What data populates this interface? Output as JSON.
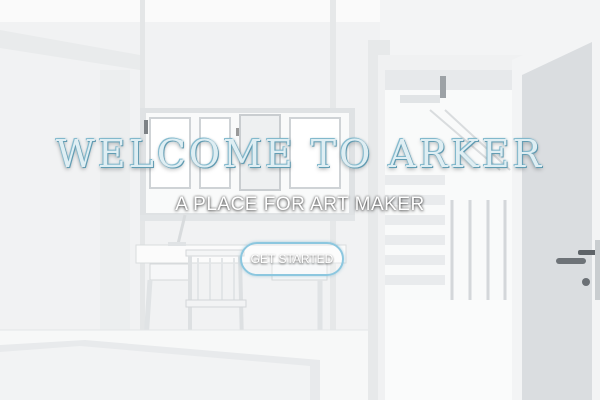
{
  "hero": {
    "title": "WELCOME TO ARKER",
    "subtitle": "A PLACE FOR ART MAKER",
    "cta_label": "GET STARTED",
    "background_image": "white-minimalist-room-with-desk-and-open-door"
  },
  "colors": {
    "title_fill": "#dfeef3",
    "title_outline": "#6aa6bd",
    "cta_border": "#8cc7df"
  }
}
